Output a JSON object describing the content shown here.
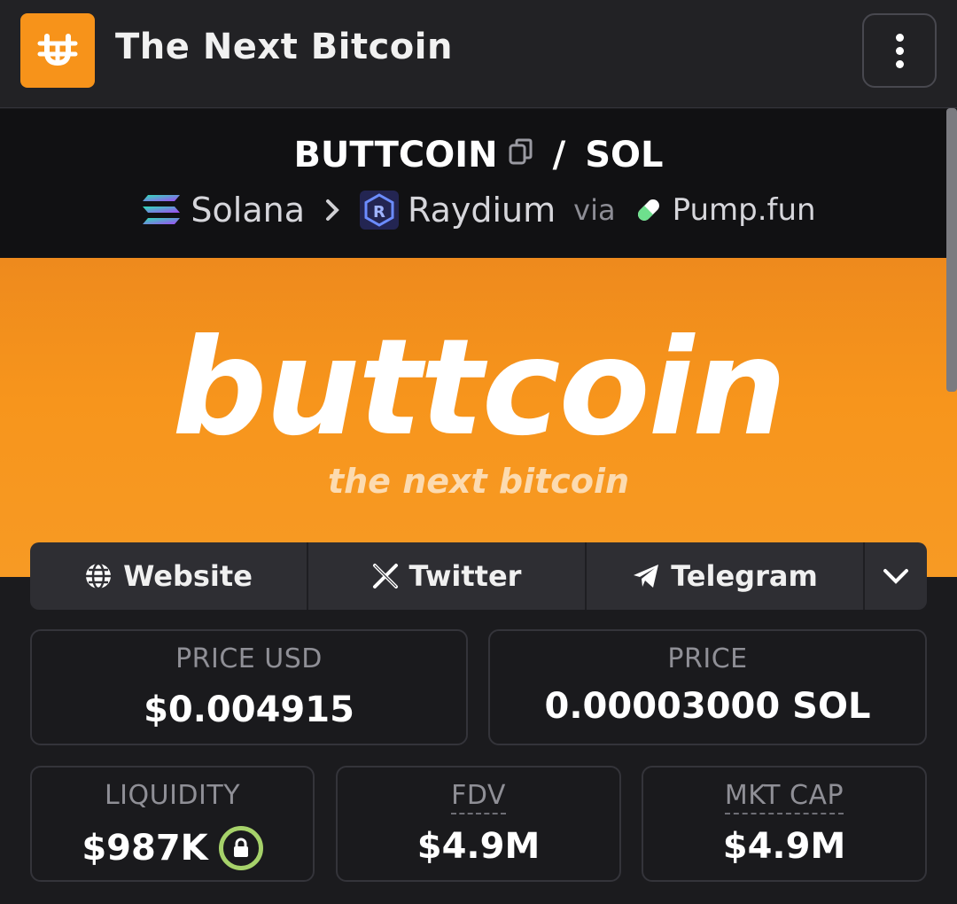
{
  "header": {
    "title": "The Next Bitcoin",
    "logo_icon": "buttcoin-logo-icon",
    "menu_icon": "more-vertical-icon",
    "accent": "#f7931a"
  },
  "pair": {
    "base": "BUTTCOIN",
    "separator": "/",
    "quote": "SOL",
    "chain": "Solana",
    "dex": "Raydium",
    "via": "via",
    "launchpad": "Pump.fun"
  },
  "banner": {
    "word": "buttcoin",
    "tagline": "the next bitcoin",
    "color": "#f7951c"
  },
  "links": {
    "website": "Website",
    "twitter": "Twitter",
    "telegram": "Telegram"
  },
  "stats": {
    "price_usd_label": "PRICE USD",
    "price_usd": "$0.004915",
    "price_label": "PRICE",
    "price": "0.00003000 SOL",
    "liquidity_label": "LIQUIDITY",
    "liquidity": "$987K",
    "fdv_label": "FDV",
    "fdv": "$4.9M",
    "mktcap_label": "MKT CAP",
    "mktcap": "$4.9M",
    "lock_color": "#a6d26a"
  }
}
